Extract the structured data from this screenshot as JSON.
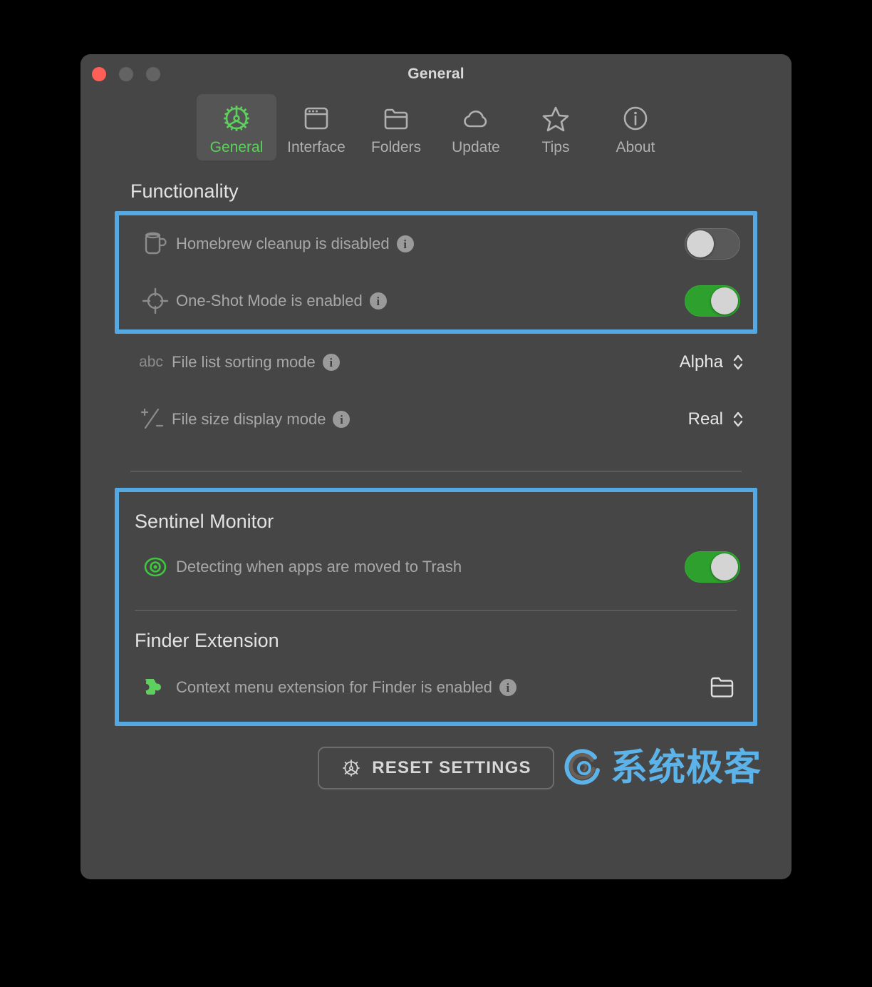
{
  "window": {
    "title": "General",
    "traffic_lights": [
      {
        "name": "close",
        "color": "#ff5f56"
      },
      {
        "name": "minimize",
        "color": "#636363"
      },
      {
        "name": "zoom",
        "color": "#636363"
      }
    ]
  },
  "toolbar": {
    "active": "General",
    "items": [
      {
        "label": "General",
        "icon": "gear-icon"
      },
      {
        "label": "Interface",
        "icon": "window-icon"
      },
      {
        "label": "Folders",
        "icon": "folder-icon"
      },
      {
        "label": "Update",
        "icon": "cloud-icon"
      },
      {
        "label": "Tips",
        "icon": "star-icon"
      },
      {
        "label": "About",
        "icon": "info-circle-icon"
      }
    ]
  },
  "functionality": {
    "heading": "Functionality",
    "rows": [
      {
        "icon": "mug-icon",
        "label": "Homebrew cleanup is disabled",
        "info": "i",
        "control": "toggle",
        "state": "off"
      },
      {
        "icon": "crosshair-icon",
        "label": "One-Shot Mode is enabled",
        "info": "i",
        "control": "toggle",
        "state": "on"
      },
      {
        "icon": "abc-icon",
        "icon_text": "abc",
        "label": "File list sorting mode",
        "info": "i",
        "control": "stepper",
        "value": "Alpha"
      },
      {
        "icon": "plus-over-minus-icon",
        "label": "File size display mode",
        "info": "i",
        "control": "stepper",
        "value": "Real"
      }
    ]
  },
  "sentinel": {
    "heading": "Sentinel Monitor",
    "row": {
      "icon": "eye-target-icon",
      "label": "Detecting when apps are moved to Trash",
      "control": "toggle",
      "state": "on"
    }
  },
  "finder_extension": {
    "heading": "Finder Extension",
    "row": {
      "icon": "puzzle-piece-icon",
      "label": "Context menu extension for Finder is enabled",
      "info": "i",
      "control": "folder-button"
    }
  },
  "footer": {
    "reset_label": "RESET SETTINGS",
    "reset_icon": "gear-icon",
    "watermark_text": "系统极客"
  },
  "colors": {
    "window_bg": "#464646",
    "highlight_border": "#55a9e2",
    "accent_green": "#5ed05e",
    "toggle_on": "#2da02d",
    "watermark_blue": "#5bb3ea",
    "label_gray": "#a8a8a8"
  }
}
